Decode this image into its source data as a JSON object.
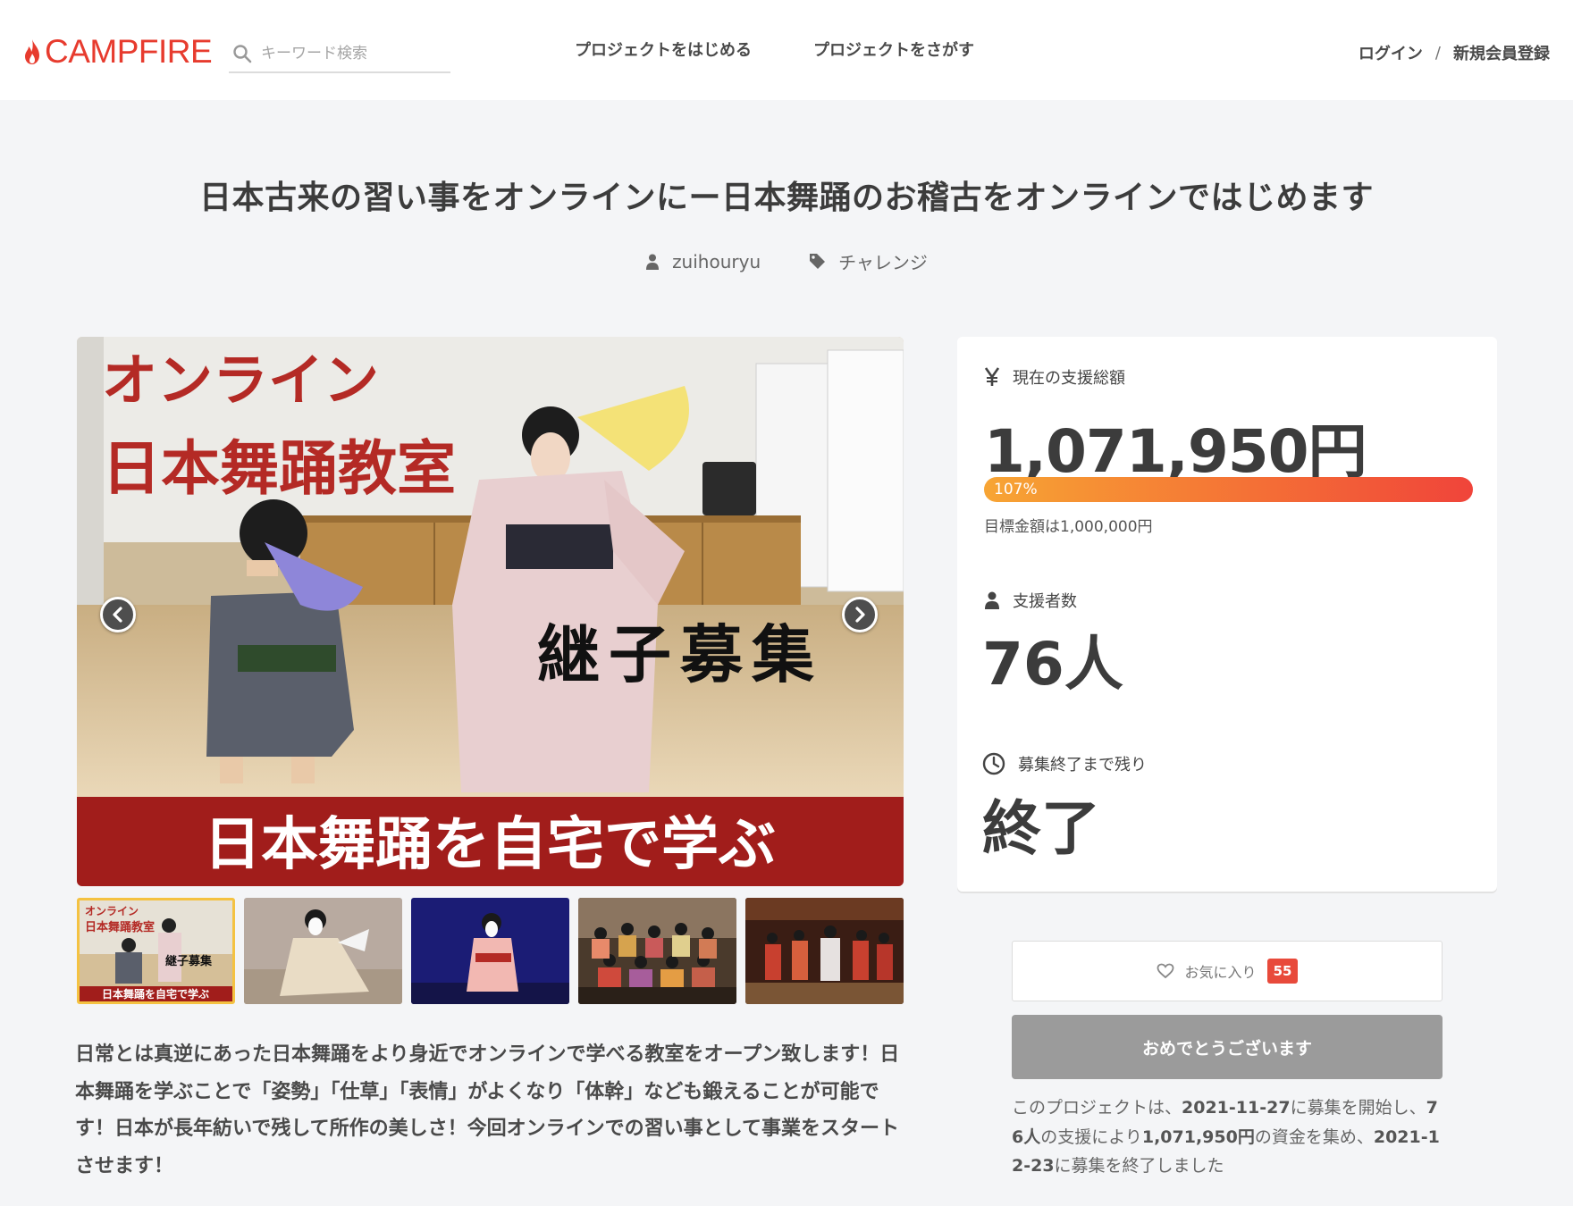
{
  "header": {
    "logo_text": "CAMPFIRE",
    "search_placeholder": "キーワード検索",
    "nav_start": "プロジェクトをはじめる",
    "nav_find": "プロジェクトをさがす",
    "login": "ログイン",
    "separator": "/",
    "signup": "新規会員登録"
  },
  "project": {
    "title": "日本古来の習い事をオンラインにー日本舞踊のお稽古をオンラインではじめます",
    "owner": "zuihouryu",
    "category": "チャレンジ"
  },
  "hero": {
    "line1": "オンライン",
    "line2": "日本舞踊教室",
    "line3": "継子募集",
    "banner": "日本舞踊を自宅で学ぶ"
  },
  "thumbnails": [
    {
      "index": 0,
      "active": true,
      "line1": "オンライン",
      "line2": "日本舞踊教室",
      "line3": "継子募集",
      "banner": "日本舞踊を自宅で学ぶ"
    },
    {
      "index": 1,
      "active": false
    },
    {
      "index": 2,
      "active": false
    },
    {
      "index": 3,
      "active": false
    },
    {
      "index": 4,
      "active": false
    }
  ],
  "description": "日常とは真逆にあった日本舞踊をより身近でオンラインで学べる教室をオープン致します！日本舞踊を学ぶことで「姿勢」「仕草」「表情」がよくなり「体幹」なども鍛えることが可能です！日本が長年紡いで残して所作の美しさ！今回オンラインでの習い事として事業をスタートさせます！",
  "stats": {
    "amount_label": "現在の支援総額",
    "amount": "1,071,950円",
    "progress_text": "107%",
    "progress_value": 1.07,
    "goal": "目標金額は1,000,000円",
    "backers_label": "支援者数",
    "backers": "76人",
    "remaining_label": "募集終了まで残り",
    "remaining": "終了"
  },
  "actions": {
    "favorite_label": "お気に入り",
    "favorite_count": "55",
    "congrats_label": "おめでとうございます"
  },
  "summary": {
    "p1": "このプロジェクトは、",
    "start_date": "2021-11-27",
    "p2": "に募集を開始し、",
    "backers": "76人",
    "p3": "の支援により",
    "amount": "1,071,950円",
    "p4": "の資金を集め、",
    "end_date": "2021-12-23",
    "p5": "に募集を終了しました"
  },
  "colors": {
    "brand": "#e73b2e",
    "progress_start": "#f7a534",
    "progress_end": "#f0443a",
    "badge": "#e84a3b",
    "button_disabled": "#9b9b9b"
  }
}
